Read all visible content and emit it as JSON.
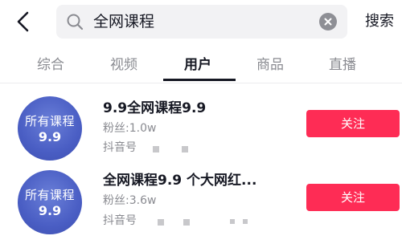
{
  "header": {
    "back_icon": "chevron-left-icon",
    "search_query": "全网课程",
    "search_action_label": "搜索"
  },
  "tabs": [
    {
      "label": "综合",
      "active": false
    },
    {
      "label": "视频",
      "active": false
    },
    {
      "label": "用户",
      "active": true
    },
    {
      "label": "商品",
      "active": false
    },
    {
      "label": "直播",
      "active": false
    }
  ],
  "results": [
    {
      "avatar_line1": "所有课程",
      "avatar_line2": "9.9",
      "name": "9.9全网课程9.9",
      "fans": "粉丝:1.0w",
      "douyin_id_label": "抖音号",
      "follow_label": "关注"
    },
    {
      "avatar_line1": "所有课程",
      "avatar_line2": "9.9",
      "name": "全网课程9.9 个大网红...",
      "fans": "粉丝:3.6w",
      "douyin_id_label": "抖音号",
      "follow_label": "关注"
    }
  ],
  "colors": {
    "accent": "#fe2c55",
    "avatar_bg": "#4a5ec4",
    "text_primary": "#161823",
    "text_secondary": "#8a8b91"
  }
}
